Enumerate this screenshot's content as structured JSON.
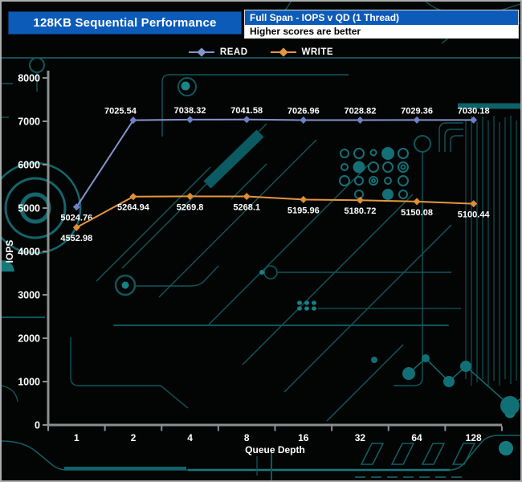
{
  "header": {
    "title": "128KB Sequential Performance",
    "subtitle": "Full Span - IOPS v QD (1 Thread)",
    "note": "Higher scores are better"
  },
  "colors": {
    "header_blue": "#0d5bb8",
    "axis_gray": "#8a8f8f",
    "label_white": "#ffffff",
    "circuit_teal": "#135c62",
    "read_line": "#8495cb",
    "read_marker": "#6b82c4",
    "write_line": "#e5973e",
    "write_marker": "#de8f35"
  },
  "legend": [
    {
      "label": "READ",
      "color": "#8495cb"
    },
    {
      "label": "WRITE",
      "color": "#e5973e"
    }
  ],
  "chart_data": {
    "type": "line",
    "title": "128KB Sequential Performance",
    "xlabel": "Queue Depth",
    "ylabel": "IOPS",
    "categories": [
      "1",
      "2",
      "4",
      "8",
      "16",
      "32",
      "64",
      "128"
    ],
    "x_scale": "categorical (powers of 2)",
    "ylim": [
      0,
      8000
    ],
    "y_ticks": [
      0,
      1000,
      2000,
      3000,
      4000,
      5000,
      6000,
      7000,
      8000
    ],
    "grid": false,
    "legend_position": "top-center",
    "series": [
      {
        "name": "READ",
        "color": "#8495cb",
        "marker_color": "#6b82c4",
        "marker": "diamond",
        "values": [
          5024.76,
          7025.54,
          7038.32,
          7041.58,
          7026.96,
          7028.82,
          7029.36,
          7030.18
        ],
        "label_sides": [
          "below",
          "above",
          "above",
          "above",
          "above",
          "above",
          "above",
          "above"
        ]
      },
      {
        "name": "WRITE",
        "color": "#e5973e",
        "marker_color": "#de8f35",
        "marker": "diamond",
        "values": [
          4552.98,
          5264.94,
          5269.8,
          5268.1,
          5195.96,
          5180.72,
          5150.08,
          5100.44
        ],
        "label_sides": [
          "below",
          "below",
          "below",
          "below",
          "below",
          "below",
          "below",
          "below"
        ]
      }
    ]
  }
}
